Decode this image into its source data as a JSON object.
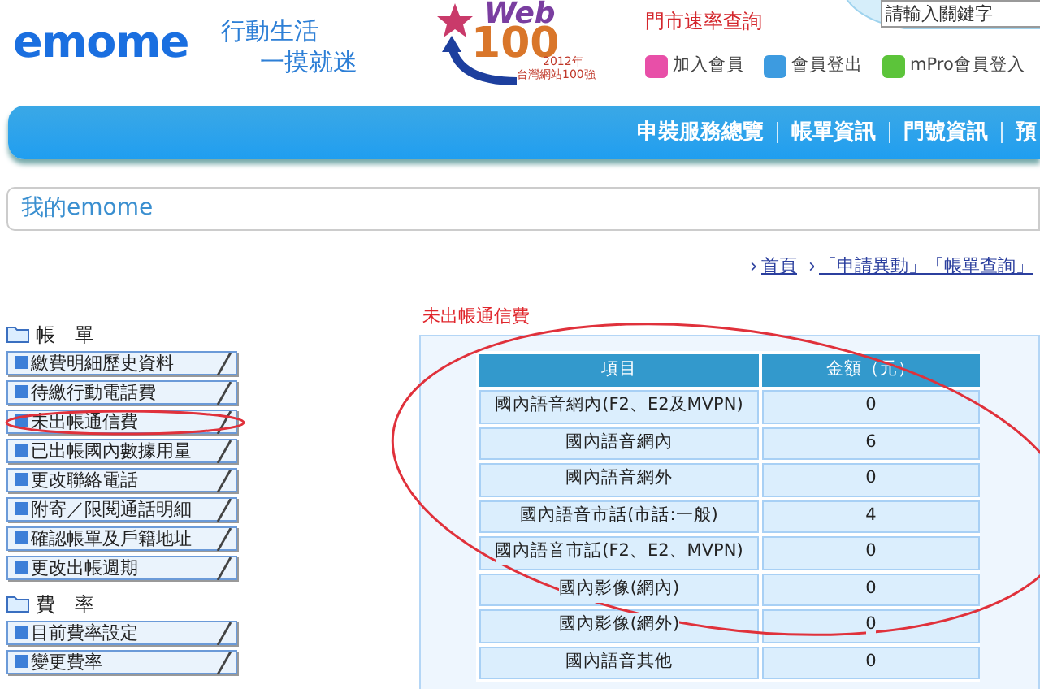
{
  "header": {
    "logo": "emome",
    "slogan": [
      "行動生活",
      "一摸就迷"
    ],
    "badge": {
      "main": "Web",
      "number": "100",
      "year": "2012年",
      "caption": "台灣網站100強"
    },
    "store_link": "門市速率查詢",
    "search": {
      "placeholder": "請輸入關鍵字"
    },
    "member_links": [
      {
        "label": "加入會員",
        "color": "#e84fa8"
      },
      {
        "label": "會員登出",
        "color": "#3d9be0"
      },
      {
        "label": "mPro會員登入",
        "color": "#5cc43a"
      }
    ]
  },
  "nav": [
    "申裝服務總覽",
    "帳單資訊",
    "門號資訊",
    "預"
  ],
  "page_title": "我的emome",
  "breadcrumb": [
    "首頁",
    "「申請異動」「帳單查詢」"
  ],
  "sidebar": [
    {
      "title": "帳　單",
      "items": [
        {
          "label": "繳費明細歷史資料",
          "circled": false
        },
        {
          "label": "待繳行動電話費",
          "circled": false
        },
        {
          "label": "未出帳通信費",
          "circled": true
        },
        {
          "label": "已出帳國內數據用量",
          "circled": false
        },
        {
          "label": "更改聯絡電話",
          "circled": false
        },
        {
          "label": "附寄／限閱通話明細",
          "circled": false
        },
        {
          "label": "確認帳單及戶籍地址",
          "circled": false
        },
        {
          "label": "更改出帳週期",
          "circled": false
        }
      ]
    },
    {
      "title": "費　率",
      "items": [
        {
          "label": "目前費率設定",
          "circled": false
        },
        {
          "label": "變更費率",
          "circled": false
        }
      ]
    }
  ],
  "content": {
    "title": "未出帳通信費",
    "circled": true,
    "table": {
      "columns": [
        "項目",
        "金額（元）"
      ],
      "rows": [
        [
          "國內語音網內(F2、E2及MVPN)",
          "0"
        ],
        [
          "國內語音網內",
          "6"
        ],
        [
          "國內語音網外",
          "0"
        ],
        [
          "國內語音市話(市話:一般)",
          "4"
        ],
        [
          "國內語音市話(F2、E2、MVPN)",
          "0"
        ],
        [
          "國內影像(網內)",
          "0"
        ],
        [
          "國內影像(網外)",
          "0"
        ],
        [
          "國內語音其他",
          "0"
        ]
      ]
    }
  }
}
